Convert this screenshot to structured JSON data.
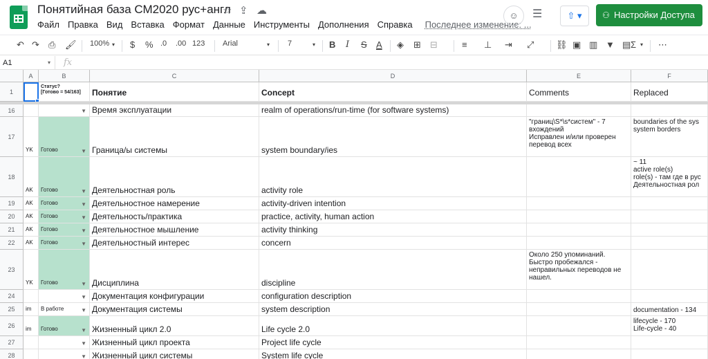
{
  "app": {
    "title": "Понятийная база СМ2020 рус+англ",
    "share_label": "Настройки Доступа",
    "last_edit": "Последнее изменение: ...",
    "menu": [
      "Файл",
      "Правка",
      "Вид",
      "Вставка",
      "Формат",
      "Данные",
      "Инструменты",
      "Дополнения",
      "Справка"
    ]
  },
  "toolbar": {
    "zoom": "100%",
    "currency": "$",
    "percent": "%",
    "dec_less": ".0",
    "dec_more": ".00",
    "more_formats": "123",
    "font": "Arial",
    "font_size": "7",
    "bold": "B",
    "italic": "I",
    "strike": "S",
    "text_color": "A",
    "sum": "Σ"
  },
  "formula_bar": {
    "name_box": "A1",
    "fx": "fx",
    "value": ""
  },
  "grid": {
    "columns": [
      "A",
      "B",
      "C",
      "D",
      "E",
      "F"
    ],
    "header_row": {
      "num": "1",
      "status": "Статус?\n[Готово = 54/163]",
      "concept_ru": "Понятие",
      "concept_en": "Concept",
      "comments": "Comments",
      "replaced": "Replaced"
    },
    "rows": [
      {
        "num": "16",
        "a": "",
        "status": "",
        "ru": "Время эксплуатации",
        "en": "realm of operations/run-time (for software systems)",
        "comments": "",
        "replaced": ""
      },
      {
        "num": "17",
        "a": "YK",
        "status": "Готово",
        "ru": "Граница/ы системы",
        "en": "system boundary/ies",
        "comments": "\"границ\\S*\\s*систем\" - 7\nвхождений\nИсправлен и/или проверен\nперевод всех",
        "replaced": "boundaries of the sys\nsystem borders"
      },
      {
        "num": "18",
        "a": "AK",
        "status": "Готово",
        "ru": "Деятельностная роль",
        "en": "activity role",
        "comments": "",
        "replaced": "~ 11\nactive role(s)\nrole(s) - там где в рус\nДеятельностная рол"
      },
      {
        "num": "19",
        "a": "AK",
        "status": "Готово",
        "ru": "Деятельностное намерение",
        "en": "activity-driven intention",
        "comments": "",
        "replaced": ""
      },
      {
        "num": "20",
        "a": "AK",
        "status": "Готово",
        "ru": "Деятельность/практика",
        "en": "practice, activity, human action",
        "comments": "",
        "replaced": ""
      },
      {
        "num": "21",
        "a": "AK",
        "status": "Готово",
        "ru": "Деятельностное мышление",
        "en": "activity thinking",
        "comments": "",
        "replaced": ""
      },
      {
        "num": "22",
        "a": "AK",
        "status": "Готово",
        "ru": "Деятельностный интерес",
        "en": "concern",
        "comments": "",
        "replaced": ""
      },
      {
        "num": "23",
        "a": "YK",
        "status": "Готово",
        "ru": "Дисциплина",
        "en": "discipline",
        "comments": "Около 250 упоминаний.\nБыстро пробежался -\nнеправильных переводов не\nнашел.",
        "replaced": ""
      },
      {
        "num": "24",
        "a": "",
        "status": "",
        "ru": "Документация конфигурации",
        "en": "configuration description",
        "comments": "",
        "replaced": ""
      },
      {
        "num": "25",
        "a": "im",
        "status": "В работе",
        "ru": "Документация системы",
        "en": "system description",
        "comments": "",
        "replaced": "documentation - 134"
      },
      {
        "num": "26",
        "a": "im",
        "status": "Готово",
        "ru": "Жизненный цикл 2.0",
        "en": "Life cycle 2.0",
        "comments": "",
        "replaced": "lifecycle - 170\nLife-cycle - 40"
      },
      {
        "num": "27",
        "a": "",
        "status": "",
        "ru": "Жизненный цикл проекта",
        "en": "Project life cycle",
        "comments": "",
        "replaced": ""
      },
      {
        "num": "28",
        "a": "",
        "status": "",
        "ru": "Жизненный цикл системы",
        "en": "System life cycle",
        "comments": "",
        "replaced": ""
      }
    ]
  }
}
